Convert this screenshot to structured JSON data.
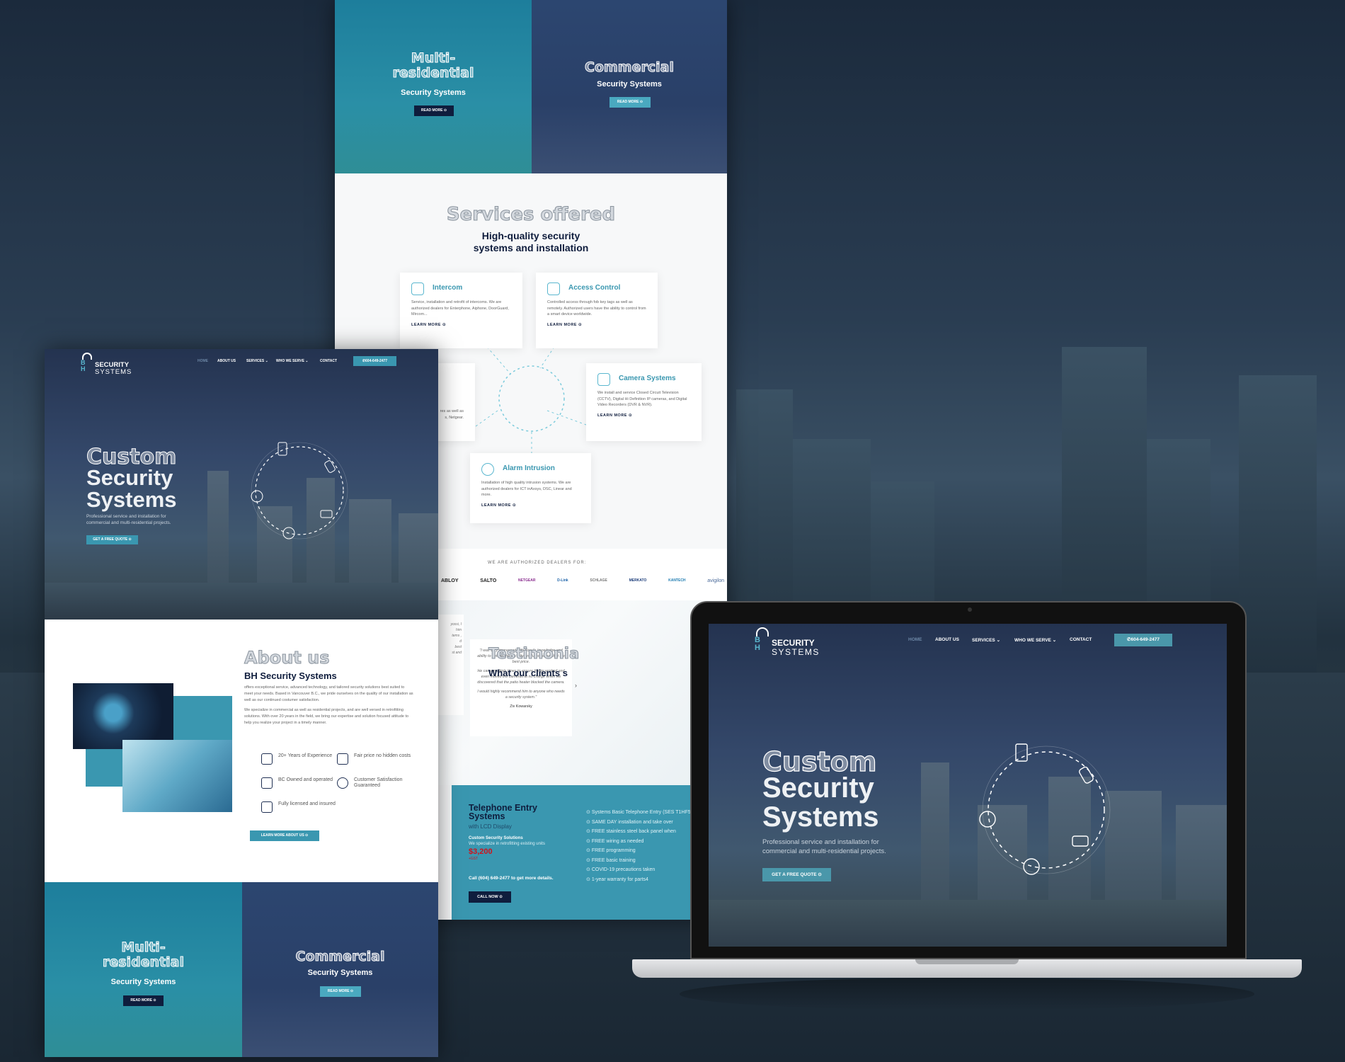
{
  "brand": {
    "logo_letters": "BH",
    "logo_word1": "SECURITY",
    "logo_word2": "SYSTEMS"
  },
  "nav": {
    "items": [
      "HOME",
      "ABOUT US",
      "SERVICES",
      "WHO WE SERVE",
      "CONTACT"
    ],
    "phone": "604-649-2477"
  },
  "hero": {
    "outline_title": "Custom",
    "title_line1": "Security",
    "title_line2": "Systems",
    "subtitle_line1": "Professional service and installation for",
    "subtitle_line2": "commercial and multi-residential projects.",
    "cta": "GET A FREE QUOTE"
  },
  "banners": {
    "multi": {
      "outline_line1": "Multi-",
      "outline_line2": "residential",
      "title": "Security Systems",
      "button": "READ MORE"
    },
    "commercial": {
      "outline": "Commercial",
      "title": "Security Systems",
      "button": "READ MORE"
    }
  },
  "services": {
    "outline_title": "Services offered",
    "subtitle_line1": "High-quality security",
    "subtitle_line2": "systems and installation",
    "learn_more": "LEARN MORE",
    "cards": [
      {
        "title": "Intercom",
        "text": "Service, installation and retrofit of intercoms. We are authorized dealers for Enterphone, Aiphone, DoorGuard, Mircom..."
      },
      {
        "title": "Access Control",
        "text": "Controlled access through fob key tags as well as remotely. Authorized users have the ability to control from a smart device worldwide."
      },
      {
        "title": "Camera Systems",
        "text": "We install and service Closed Circuit Television (CCTV), Digital Hi Definition IP cameras, and Digital Video Recorders (DVR & NVR)."
      },
      {
        "title": "Alarm Intrusion",
        "text": "Installation of high quality intrusion systems. We are authorized dealers for ICT inAxsys, DSC, Linear and more."
      },
      {
        "title": "",
        "text_line1": "res as well as",
        "text_line2": "s, Netgear."
      }
    ]
  },
  "dealers": {
    "label": "WE ARE AUTHORIZED DEALERS FOR:",
    "logos": [
      "ABLOY",
      "SALTO",
      "NETGEAR",
      "D-Link",
      "SCHLAGE",
      "MERKATO",
      "KANTECH",
      "avigilon"
    ]
  },
  "testimonials": {
    "outline_title": "Testimonia",
    "subtitle": "What our clients s",
    "quote_p1": "\"I was very impressed with Yossi's knowledge and ability to get me the security products I wanted at the best price.",
    "quote_p2": "He came multiple times to ensure things worked and even moved the cameras at no charge when we discovered that the patio heater blocked the camera.",
    "quote_p3": "I would highly recommend him to anyone who needs a security system.\"",
    "author": "Ziv Kowarsky",
    "prev_fragments": [
      "yossi, I",
      "him",
      "tems ,",
      "d",
      "best",
      "st and"
    ]
  },
  "promo": {
    "title_line1": "Telephone Entry",
    "title_line2": "Systems",
    "subtitle": "with LCD Display",
    "label": "Custom Security Solutions",
    "label_sub": "We specialize in retrofitting existing units",
    "price": "$3,200",
    "price_note": "+GST",
    "call_text": "Call (604) 649-2477 to get more details.",
    "button": "CALL NOW",
    "features": [
      "Systems Basic Telephone Entry (SES T1HF503)",
      "SAME DAY installation and take over",
      "FREE stainless steel back panel when",
      "FREE wiring as needed",
      "FREE programming",
      "FREE basic training",
      "COVID-19 precautions taken",
      "1-year warranty for parts4"
    ]
  },
  "about": {
    "outline_title": "About us",
    "title": "BH Security Systems",
    "p1": "offers exceptional service, advanced technology, and tailored security solutions best suited to meet your needs. Based in Vancouver B.C., we pride ourselves on the quality of our installation as well as our continued costumer satisfaction.",
    "p2": "We specialize in commercial as well as residential projects, and are well versed in retrofitting solutions. With over 20 years in the field, we bring our expertise and solution focused attitude to help you realize your project in a timely manner.",
    "features": [
      "20+ Years of Experience",
      "Fair price no hidden costs",
      "BC Owned and operated",
      "Customer Satisfaction Guaranteed",
      "Fully licensed and insured"
    ],
    "button": "LEARN MORE ABOUT US"
  },
  "colors": {
    "teal": "#3a97b0",
    "navy": "#0f1d3d",
    "price_red": "#d0121b"
  }
}
